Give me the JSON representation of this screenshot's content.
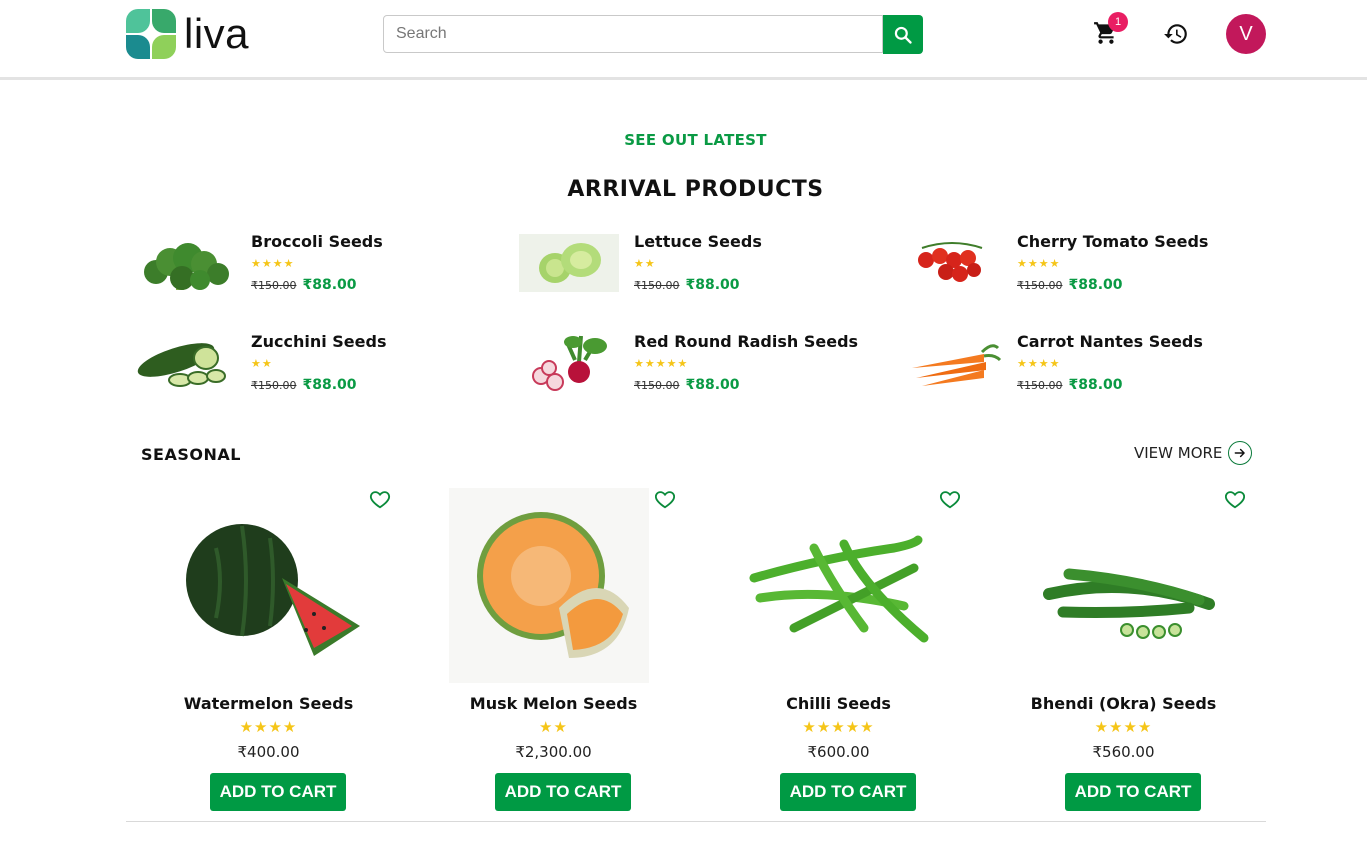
{
  "header": {
    "logo_text": "liva",
    "search_placeholder": "Search",
    "cart_count": "1",
    "avatar_letter": "V"
  },
  "arrival": {
    "eyebrow": "SEE OUT LATEST",
    "title": "ARRIVAL PRODUCTS",
    "items": [
      {
        "name": "Broccoli Seeds",
        "stars": "★★★★",
        "old_price": "₹150.00",
        "price": "₹88.00"
      },
      {
        "name": "Lettuce Seeds",
        "stars": "★★",
        "old_price": "₹150.00",
        "price": "₹88.00"
      },
      {
        "name": "Cherry Tomato Seeds",
        "stars": "★★★★",
        "old_price": "₹150.00",
        "price": "₹88.00"
      },
      {
        "name": "Zucchini Seeds",
        "stars": "★★",
        "old_price": "₹150.00",
        "price": "₹88.00"
      },
      {
        "name": "Red Round Radish Seeds",
        "stars": "★★★★★",
        "old_price": "₹150.00",
        "price": "₹88.00"
      },
      {
        "name": "Carrot Nantes Seeds",
        "stars": "★★★★",
        "old_price": "₹150.00",
        "price": "₹88.00"
      }
    ]
  },
  "seasonal": {
    "title": "SEASONAL",
    "view_more": "VIEW MORE",
    "add_label": "ADD TO CART",
    "products": [
      {
        "name": "Watermelon Seeds",
        "stars": "★★★★",
        "price": "₹400.00"
      },
      {
        "name": "Musk Melon Seeds",
        "stars": "★★",
        "price": "₹2,300.00"
      },
      {
        "name": "Chilli Seeds",
        "stars": "★★★★★",
        "price": "₹600.00"
      },
      {
        "name": "Bhendi (Okra) Seeds",
        "stars": "★★★★",
        "price": "₹560.00"
      }
    ]
  },
  "colors": {
    "brand_green": "#009a44",
    "badge_pink": "#e91e63",
    "avatar": "#c2185b",
    "star": "#f5c518"
  }
}
